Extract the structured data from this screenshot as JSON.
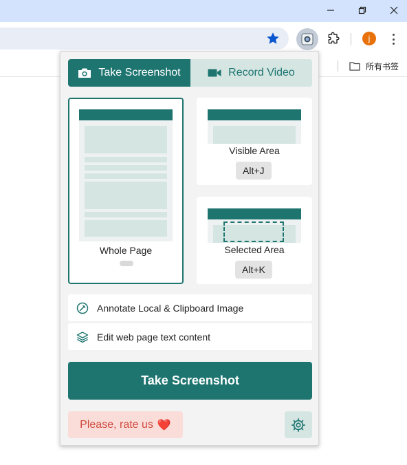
{
  "browser": {
    "window_controls": {
      "minimize_icon": "minimize-icon",
      "restore_icon": "restore-icon",
      "close_icon": "close-icon"
    },
    "toolbar": {
      "profile_initial": "j",
      "avatar_color": "#e8710a"
    },
    "bookmarks_bar": {
      "folder_label": "所有书签"
    }
  },
  "popup": {
    "tabs": [
      {
        "label": "Take Screenshot",
        "icon": "camera-icon",
        "active": true
      },
      {
        "label": "Record Video",
        "icon": "video-camera-icon",
        "active": false
      }
    ],
    "capture_modes": {
      "whole_page": {
        "label": "Whole Page",
        "shortcut": ""
      },
      "visible_area": {
        "label": "Visible Area",
        "shortcut": "Alt+J"
      },
      "selected_area": {
        "label": "Selected Area",
        "shortcut": "Alt+K"
      }
    },
    "options": [
      {
        "label": "Annotate Local & Clipboard Image",
        "icon": "annotate-icon"
      },
      {
        "label": "Edit web page text content",
        "icon": "layers-icon"
      }
    ],
    "primary_button": "Take Screenshot",
    "rate_button": "Please, rate us",
    "rate_emoji": "❤️",
    "settings_icon": "gear-icon"
  },
  "colors": {
    "accent": "#1e7570",
    "accent_light": "#d4e5e2",
    "rate_bg": "#fadcd9",
    "rate_text": "#d04a3c",
    "titlebar": "#d3e3fd"
  }
}
